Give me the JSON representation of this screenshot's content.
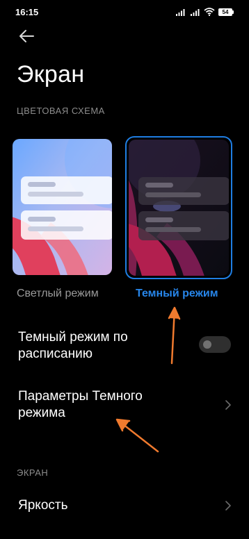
{
  "status_bar": {
    "time": "16:15",
    "battery": "54"
  },
  "header": {
    "title": "Экран"
  },
  "color_scheme": {
    "section_label": "ЦВЕТОВАЯ СХЕМА",
    "options": [
      {
        "label": "Светлый режим",
        "selected": false
      },
      {
        "label": "Темный режим",
        "selected": true
      }
    ]
  },
  "settings": {
    "dark_schedule": {
      "label_line1": "Темный режим по",
      "label_line2": "расписанию",
      "enabled": false
    },
    "dark_params": {
      "label_line1": "Параметры Темного",
      "label_line2": "режима"
    }
  },
  "screen_section": {
    "section_label": "ЭКРАН",
    "brightness_label": "Яркость"
  },
  "colors": {
    "accent": "#2786ea",
    "arrow": "#f07a2e",
    "background": "#000000"
  }
}
